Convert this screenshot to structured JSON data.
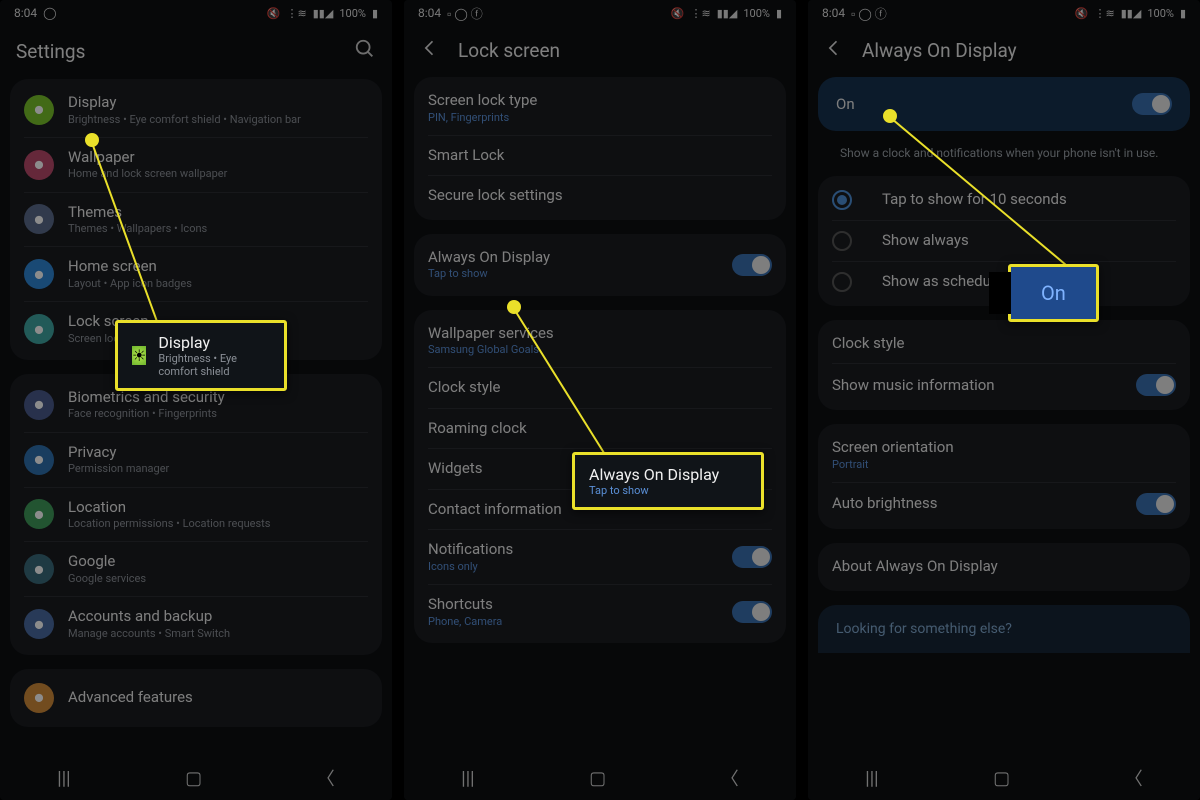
{
  "status": {
    "time": "8:04",
    "battery": "100%"
  },
  "s1": {
    "title": "Settings",
    "items": [
      {
        "icon_bg": "#78c12b",
        "title": "Display",
        "sub": "Brightness  •  Eye comfort shield  •  Navigation bar"
      },
      {
        "icon_bg": "#b84a6a",
        "title": "Wallpaper",
        "sub": "Home and lock screen wallpaper"
      },
      {
        "icon_bg": "#5a6a8a",
        "title": "Themes",
        "sub": "Themes  •  Wallpapers  •  Icons"
      },
      {
        "icon_bg": "#2f86d4",
        "title": "Home screen",
        "sub": "Layout  •  App icon badges"
      },
      {
        "icon_bg": "#3fa5a0",
        "title": "Lock screen",
        "sub": "Screen lock type  •  Always On Display"
      }
    ],
    "items2": [
      {
        "icon_bg": "#4a5a8a",
        "title": "Biometrics and security",
        "sub": "Face recognition  •  Fingerprints"
      },
      {
        "icon_bg": "#2e6fae",
        "title": "Privacy",
        "sub": "Permission manager"
      },
      {
        "icon_bg": "#3f9a5a",
        "title": "Location",
        "sub": "Location permissions  •  Location requests"
      },
      {
        "icon_bg": "#3a6a7a",
        "title": "Google",
        "sub": "Google services"
      },
      {
        "icon_bg": "#4a6aa0",
        "title": "Accounts and backup",
        "sub": "Manage accounts  •  Smart Switch"
      }
    ],
    "items3": [
      {
        "icon_bg": "#d08a3a",
        "title": "Advanced features",
        "sub": ""
      }
    ],
    "callout": {
      "title": "Display",
      "sub": "Brightness  •  Eye comfort shield"
    }
  },
  "s2": {
    "title": "Lock screen",
    "g1": [
      {
        "title": "Screen lock type",
        "sub": "PIN, Fingerprints",
        "blue": true
      },
      {
        "title": "Smart Lock"
      },
      {
        "title": "Secure lock settings"
      }
    ],
    "g2": [
      {
        "title": "Always On Display",
        "sub": "Tap to show",
        "blue": true,
        "toggle": true
      }
    ],
    "g3": [
      {
        "title": "Wallpaper services",
        "sub": "Samsung Global Goals",
        "blue": true
      },
      {
        "title": "Clock style"
      },
      {
        "title": "Roaming clock"
      },
      {
        "title": "Widgets"
      },
      {
        "title": "Contact information"
      },
      {
        "title": "Notifications",
        "sub": "Icons only",
        "blue": true,
        "toggle": true
      },
      {
        "title": "Shortcuts",
        "sub": "Phone, Camera",
        "blue": true,
        "toggle": true
      }
    ],
    "callout": {
      "title": "Always On Display",
      "sub": "Tap to show"
    }
  },
  "s3": {
    "title": "Always On Display",
    "on_label": "On",
    "desc": "Show a clock and notifications when your phone isn't in use.",
    "radios": [
      {
        "label": "Tap to show for 10 seconds",
        "on": true
      },
      {
        "label": "Show always"
      },
      {
        "label": "Show as scheduled"
      }
    ],
    "g2": [
      {
        "title": "Clock style"
      },
      {
        "title": "Show music information",
        "toggle": true
      }
    ],
    "g3": [
      {
        "title": "Screen orientation",
        "sub": "Portrait",
        "blue": true
      },
      {
        "title": "Auto brightness",
        "toggle": true
      }
    ],
    "g4": [
      {
        "title": "About Always On Display"
      }
    ],
    "footer": "Looking for something else?",
    "callout": {
      "title": "On"
    }
  }
}
